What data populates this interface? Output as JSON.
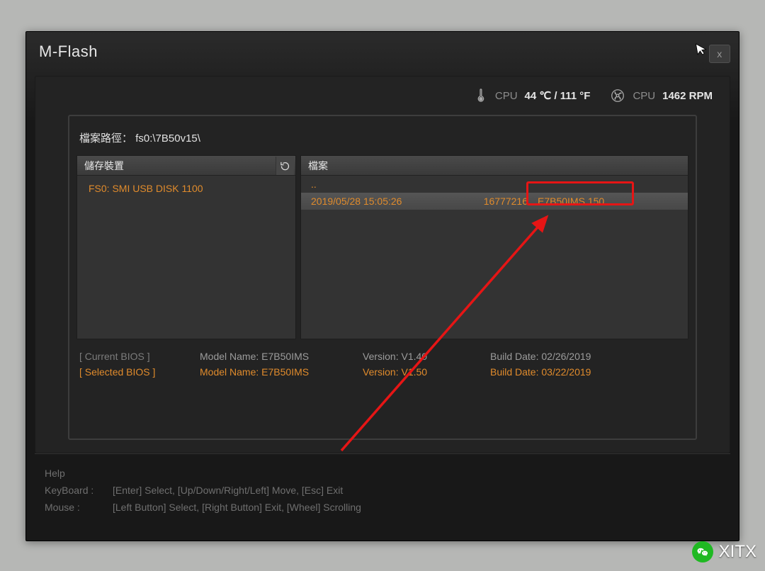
{
  "window": {
    "title": "M-Flash",
    "close": "x"
  },
  "status": {
    "cpu_temp_label": "CPU",
    "cpu_temp_value": "44 ℃ / 111 °F",
    "cpu_fan_label": "CPU",
    "cpu_fan_value": "1462 RPM"
  },
  "panel": {
    "path_label": "檔案路徑：",
    "path_value": "fs0:\\7B50v15\\",
    "devices_header": "儲存裝置",
    "files_header": "檔案",
    "device_item": "FS0: SMI USB DISK 1100",
    "file_up": "..",
    "file": {
      "date": "2019/05/28 15:05:26",
      "size": "16777216",
      "name": "E7B50IMS.150"
    }
  },
  "bios": {
    "current_label": "[ Current BIOS  ]",
    "selected_label": "[ Selected BIOS ]",
    "model_label": "Model Name:",
    "version_label": "Version:",
    "build_label": "Build Date:",
    "current": {
      "model": "E7B50IMS",
      "version": "V1.40",
      "build": "02/26/2019"
    },
    "selected": {
      "model": "E7B50IMS",
      "version": "V1.50",
      "build": "03/22/2019"
    }
  },
  "help": {
    "title": "Help",
    "row1_label": "KeyBoard :",
    "row1_text": "[Enter]  Select,    [Up/Down/Right/Left]  Move,    [Esc]  Exit",
    "row2_label": "Mouse     :",
    "row2_text": "[Left Button]  Select,    [Right Button]  Exit,    [Wheel]  Scrolling"
  },
  "watermark": "XITX"
}
